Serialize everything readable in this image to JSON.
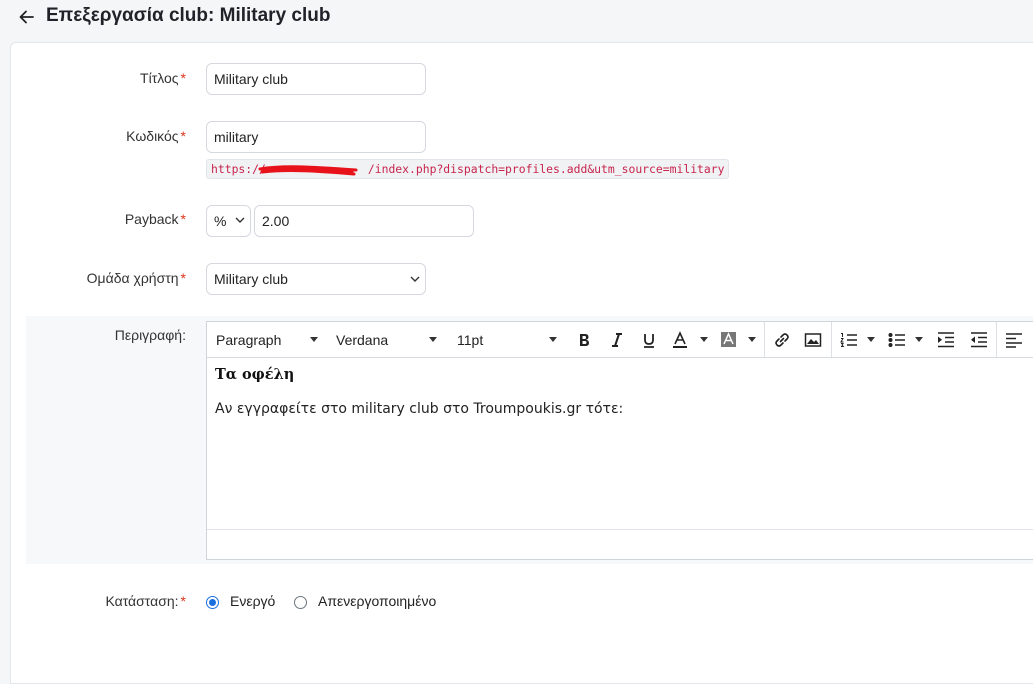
{
  "header": {
    "title": "Επεξεργασία club: Military club",
    "back_icon": "arrow-left-icon"
  },
  "form": {
    "title_label": "Τίτλος",
    "title_value": "Military club",
    "code_label": "Κωδικός",
    "code_value": "military",
    "code_url_prefix": "https://",
    "code_url_suffix": "/index.php?dispatch=profiles.add&utm_source=military",
    "payback_label": "Payback",
    "payback_type": "%",
    "payback_value": "2.00",
    "group_label": "Ομάδα χρήστη",
    "group_value": "Military club",
    "description_label": "Περιγραφή:",
    "status_label": "Κατάσταση:",
    "status_active": "Ενεργό",
    "status_inactive": "Απενεργοποιημένο",
    "required_mark": "*"
  },
  "editor": {
    "block_format": "Paragraph",
    "font_family": "Verdana",
    "font_size": "11pt",
    "content_heading": "Τα οφέλη",
    "content_paragraph": "Αν εγγραφείτε στο military club στο Troumpoukis.gr τότε:"
  },
  "colors": {
    "required": "#e0321b",
    "radio_accent": "#1a6fe0",
    "url_text": "#c7254e"
  }
}
